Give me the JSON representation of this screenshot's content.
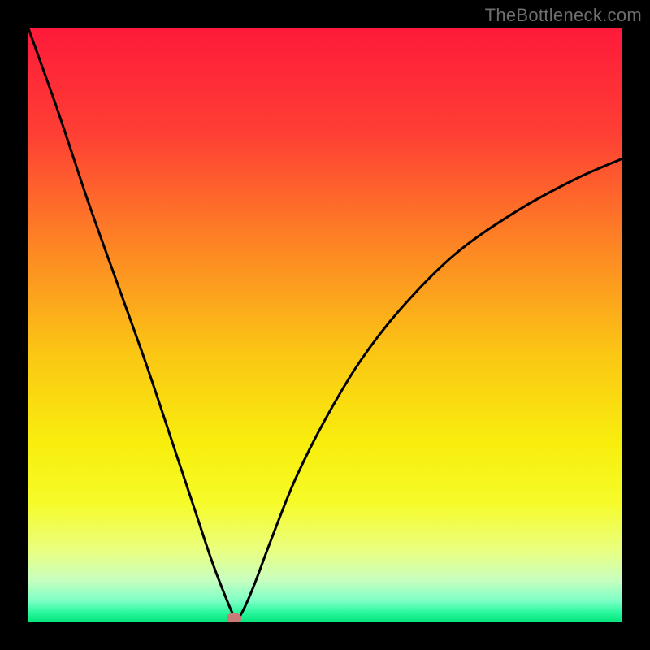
{
  "watermark": {
    "text": "TheBottleneck.com"
  },
  "colors": {
    "black": "#000000",
    "curve": "#000000",
    "marker": "#c77a76",
    "gradient_stops": [
      {
        "t": 0.0,
        "c": "#fe1a3a"
      },
      {
        "t": 0.18,
        "c": "#fe4034"
      },
      {
        "t": 0.38,
        "c": "#fd8a23"
      },
      {
        "t": 0.55,
        "c": "#fbc714"
      },
      {
        "t": 0.7,
        "c": "#f8ee0d"
      },
      {
        "t": 0.8,
        "c": "#f6fb29"
      },
      {
        "t": 0.88,
        "c": "#eaff80"
      },
      {
        "t": 0.93,
        "c": "#c8ffbf"
      },
      {
        "t": 0.965,
        "c": "#7dffc6"
      },
      {
        "t": 0.985,
        "c": "#28f89d"
      },
      {
        "t": 1.0,
        "c": "#07e57d"
      }
    ]
  },
  "chart_data": {
    "type": "line",
    "title": "",
    "xlabel": "",
    "ylabel": "",
    "xlim": [
      0,
      100
    ],
    "ylim": [
      0,
      100
    ],
    "legend": false,
    "grid": false,
    "note": "Axes unlabeled; values below are estimated from pixel position as percentage of plot area. y=0 at bottom (green), y=100 at top (red).",
    "series": [
      {
        "name": "bottleneck-curve",
        "x": [
          0,
          5,
          10,
          15,
          20,
          25,
          28,
          31,
          33.5,
          34.5,
          35,
          36,
          38,
          41,
          45,
          50,
          56,
          63,
          72,
          82,
          92,
          100
        ],
        "y": [
          100,
          86,
          71,
          57,
          43,
          28,
          19,
          10,
          3.5,
          1.2,
          0.5,
          1.5,
          6,
          14,
          24,
          34,
          44,
          53,
          62,
          69,
          74.5,
          78
        ]
      }
    ],
    "annotations": [
      {
        "name": "min-marker",
        "x": 34.7,
        "y": 0.6
      }
    ]
  }
}
